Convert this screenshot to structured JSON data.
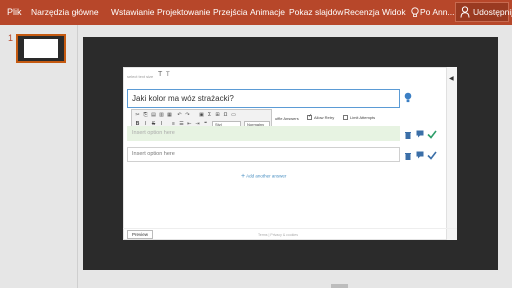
{
  "ribbon": {
    "file_tab": "Plik",
    "tabs": [
      "Narzędzia główne",
      "Wstawianie",
      "Projektowanie",
      "Przejścia",
      "Animacje",
      "Pokaz slajdów",
      "Recenzja",
      "Widok"
    ],
    "tell_me": "Po",
    "user": "Ann...",
    "share_label": "Udostępnij",
    "bg_color": "#b7472a"
  },
  "slides_panel": {
    "slide_number": "1"
  },
  "quiz": {
    "type_label": "select text size",
    "type_t_large": "T",
    "type_t_small": "T",
    "question": "Jaki kolor ma wóz strażacki?",
    "toolbar": {
      "style_select": "Styl",
      "format_select": "Normalny"
    },
    "settings": {
      "shuffle": "uffle Answers",
      "allow_retry": "Allow Retry",
      "limit_attempts": "Limit Attempts"
    },
    "options": [
      {
        "placeholder": "Insert option here",
        "correct": true
      },
      {
        "placeholder": "Insert option here",
        "correct": false
      }
    ],
    "add_answer": "Add another answer",
    "preview": "Preview",
    "footer_links": "Terms | Privacy & cookies"
  }
}
